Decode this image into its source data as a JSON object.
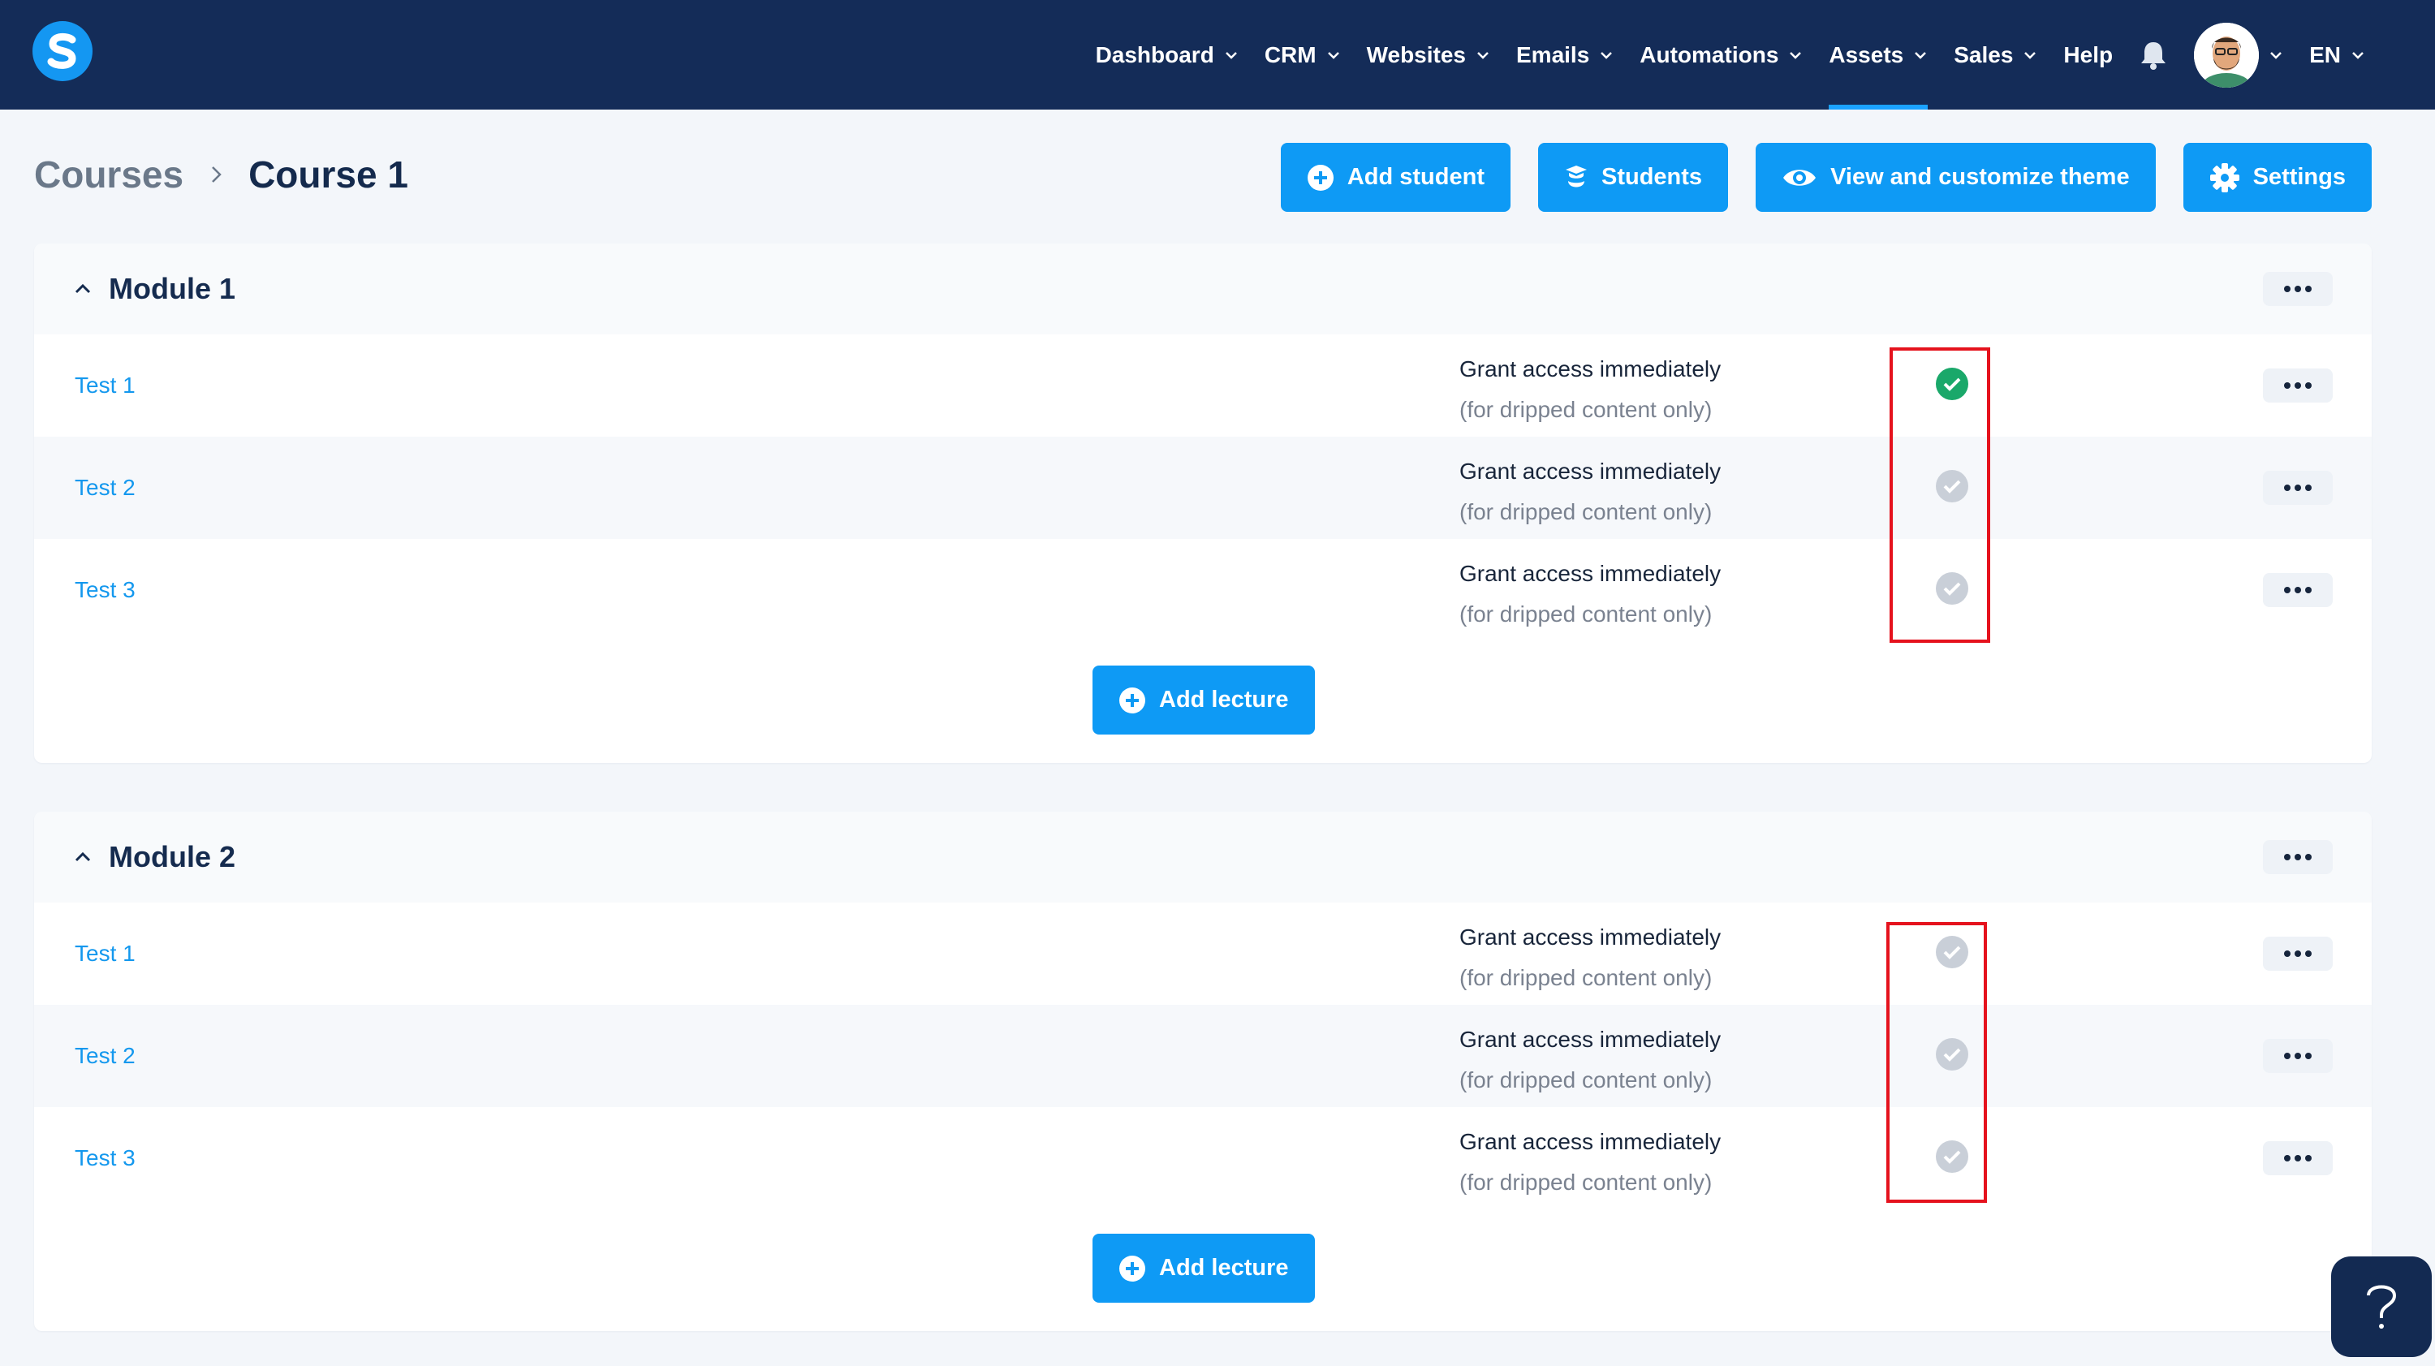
{
  "nav": {
    "items": [
      {
        "label": "Dashboard",
        "dropdown": true
      },
      {
        "label": "CRM",
        "dropdown": true
      },
      {
        "label": "Websites",
        "dropdown": true
      },
      {
        "label": "Emails",
        "dropdown": true
      },
      {
        "label": "Automations",
        "dropdown": true
      },
      {
        "label": "Assets",
        "dropdown": true,
        "active": true
      },
      {
        "label": "Sales",
        "dropdown": true
      },
      {
        "label": "Help",
        "dropdown": false
      }
    ],
    "language": "EN"
  },
  "breadcrumb": {
    "parent": "Courses",
    "current": "Course 1"
  },
  "actions": {
    "add_student": "Add student",
    "students": "Students",
    "view_theme": "View and customize theme",
    "settings": "Settings"
  },
  "modules": [
    {
      "title": "Module 1",
      "lectures": [
        {
          "title": "Test 1",
          "grant": "Grant access immediately",
          "grant_note": "(for dripped content only)",
          "checked": true
        },
        {
          "title": "Test 2",
          "grant": "Grant access immediately",
          "grant_note": "(for dripped content only)",
          "checked": false
        },
        {
          "title": "Test 3",
          "grant": "Grant access immediately",
          "grant_note": "(for dripped content only)",
          "checked": false
        }
      ],
      "add_lecture": "Add lecture"
    },
    {
      "title": "Module 2",
      "lectures": [
        {
          "title": "Test 1",
          "grant": "Grant access immediately",
          "grant_note": "(for dripped content only)",
          "checked": false
        },
        {
          "title": "Test 2",
          "grant": "Grant access immediately",
          "grant_note": "(for dripped content only)",
          "checked": false
        },
        {
          "title": "Test 3",
          "grant": "Grant access immediately",
          "grant_note": "(for dripped content only)",
          "checked": false
        }
      ],
      "add_lecture": "Add lecture"
    }
  ],
  "colors": {
    "nav_bg": "#142c58",
    "primary": "#0e9af5",
    "check_on": "#1aa86a",
    "check_off": "#c9cfd8",
    "highlight": "#e5121d"
  }
}
